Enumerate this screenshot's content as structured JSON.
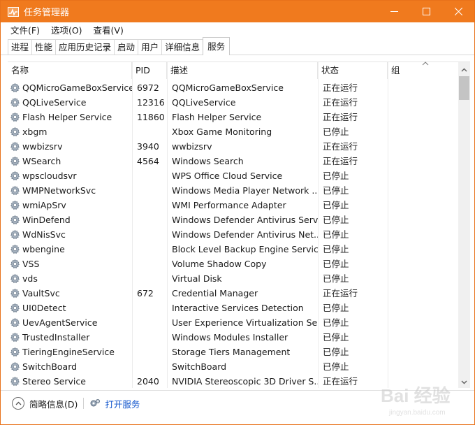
{
  "window": {
    "title": "任务管理器"
  },
  "menubar": [
    "文件(F)",
    "选项(O)",
    "查看(V)"
  ],
  "tabs": [
    {
      "label": "进程"
    },
    {
      "label": "性能"
    },
    {
      "label": "应用历史记录"
    },
    {
      "label": "启动"
    },
    {
      "label": "用户"
    },
    {
      "label": "详细信息"
    },
    {
      "label": "服务",
      "active": true
    }
  ],
  "columns": {
    "name": "名称",
    "pid": "PID",
    "desc": "描述",
    "status": "状态",
    "group": "组"
  },
  "services": [
    {
      "name": "QQMicroGameBoxService",
      "pid": "6972",
      "desc": "QQMicroGameBoxService",
      "status": "正在运行",
      "group": ""
    },
    {
      "name": "QQLiveService",
      "pid": "12316",
      "desc": "QQLiveService",
      "status": "正在运行",
      "group": ""
    },
    {
      "name": "Flash Helper Service",
      "pid": "11860",
      "desc": "Flash Helper Service",
      "status": "正在运行",
      "group": ""
    },
    {
      "name": "xbgm",
      "pid": "",
      "desc": "Xbox Game Monitoring",
      "status": "已停止",
      "group": ""
    },
    {
      "name": "wwbizsrv",
      "pid": "3940",
      "desc": "wwbizsrv",
      "status": "正在运行",
      "group": ""
    },
    {
      "name": "WSearch",
      "pid": "4564",
      "desc": "Windows Search",
      "status": "正在运行",
      "group": ""
    },
    {
      "name": "wpscloudsvr",
      "pid": "",
      "desc": "WPS Office Cloud Service",
      "status": "已停止",
      "group": ""
    },
    {
      "name": "WMPNetworkSvc",
      "pid": "",
      "desc": "Windows Media Player Network ...",
      "status": "已停止",
      "group": ""
    },
    {
      "name": "wmiApSrv",
      "pid": "",
      "desc": "WMI Performance Adapter",
      "status": "已停止",
      "group": ""
    },
    {
      "name": "WinDefend",
      "pid": "",
      "desc": "Windows Defender Antivirus Serv...",
      "status": "已停止",
      "group": ""
    },
    {
      "name": "WdNisSvc",
      "pid": "",
      "desc": "Windows Defender Antivirus Net...",
      "status": "已停止",
      "group": ""
    },
    {
      "name": "wbengine",
      "pid": "",
      "desc": "Block Level Backup Engine Service",
      "status": "已停止",
      "group": ""
    },
    {
      "name": "VSS",
      "pid": "",
      "desc": "Volume Shadow Copy",
      "status": "已停止",
      "group": ""
    },
    {
      "name": "vds",
      "pid": "",
      "desc": "Virtual Disk",
      "status": "已停止",
      "group": ""
    },
    {
      "name": "VaultSvc",
      "pid": "672",
      "desc": "Credential Manager",
      "status": "正在运行",
      "group": ""
    },
    {
      "name": "UI0Detect",
      "pid": "",
      "desc": "Interactive Services Detection",
      "status": "已停止",
      "group": ""
    },
    {
      "name": "UevAgentService",
      "pid": "",
      "desc": "User Experience Virtualization Se...",
      "status": "已停止",
      "group": ""
    },
    {
      "name": "TrustedInstaller",
      "pid": "",
      "desc": "Windows Modules Installer",
      "status": "已停止",
      "group": ""
    },
    {
      "name": "TieringEngineService",
      "pid": "",
      "desc": "Storage Tiers Management",
      "status": "已停止",
      "group": ""
    },
    {
      "name": "SwitchBoard",
      "pid": "",
      "desc": "SwitchBoard",
      "status": "已停止",
      "group": ""
    },
    {
      "name": "Stereo Service",
      "pid": "2040",
      "desc": "NVIDIA Stereoscopic 3D Driver S...",
      "status": "正在运行",
      "group": ""
    }
  ],
  "footer": {
    "fewer_details": "简略信息(D)",
    "open_services": "打开服务"
  },
  "watermark": {
    "brand": "Bai 经验",
    "url": "jingyan.baidu.com"
  },
  "colors": {
    "titlebar": "#f07a1e",
    "link": "#1155cc"
  }
}
